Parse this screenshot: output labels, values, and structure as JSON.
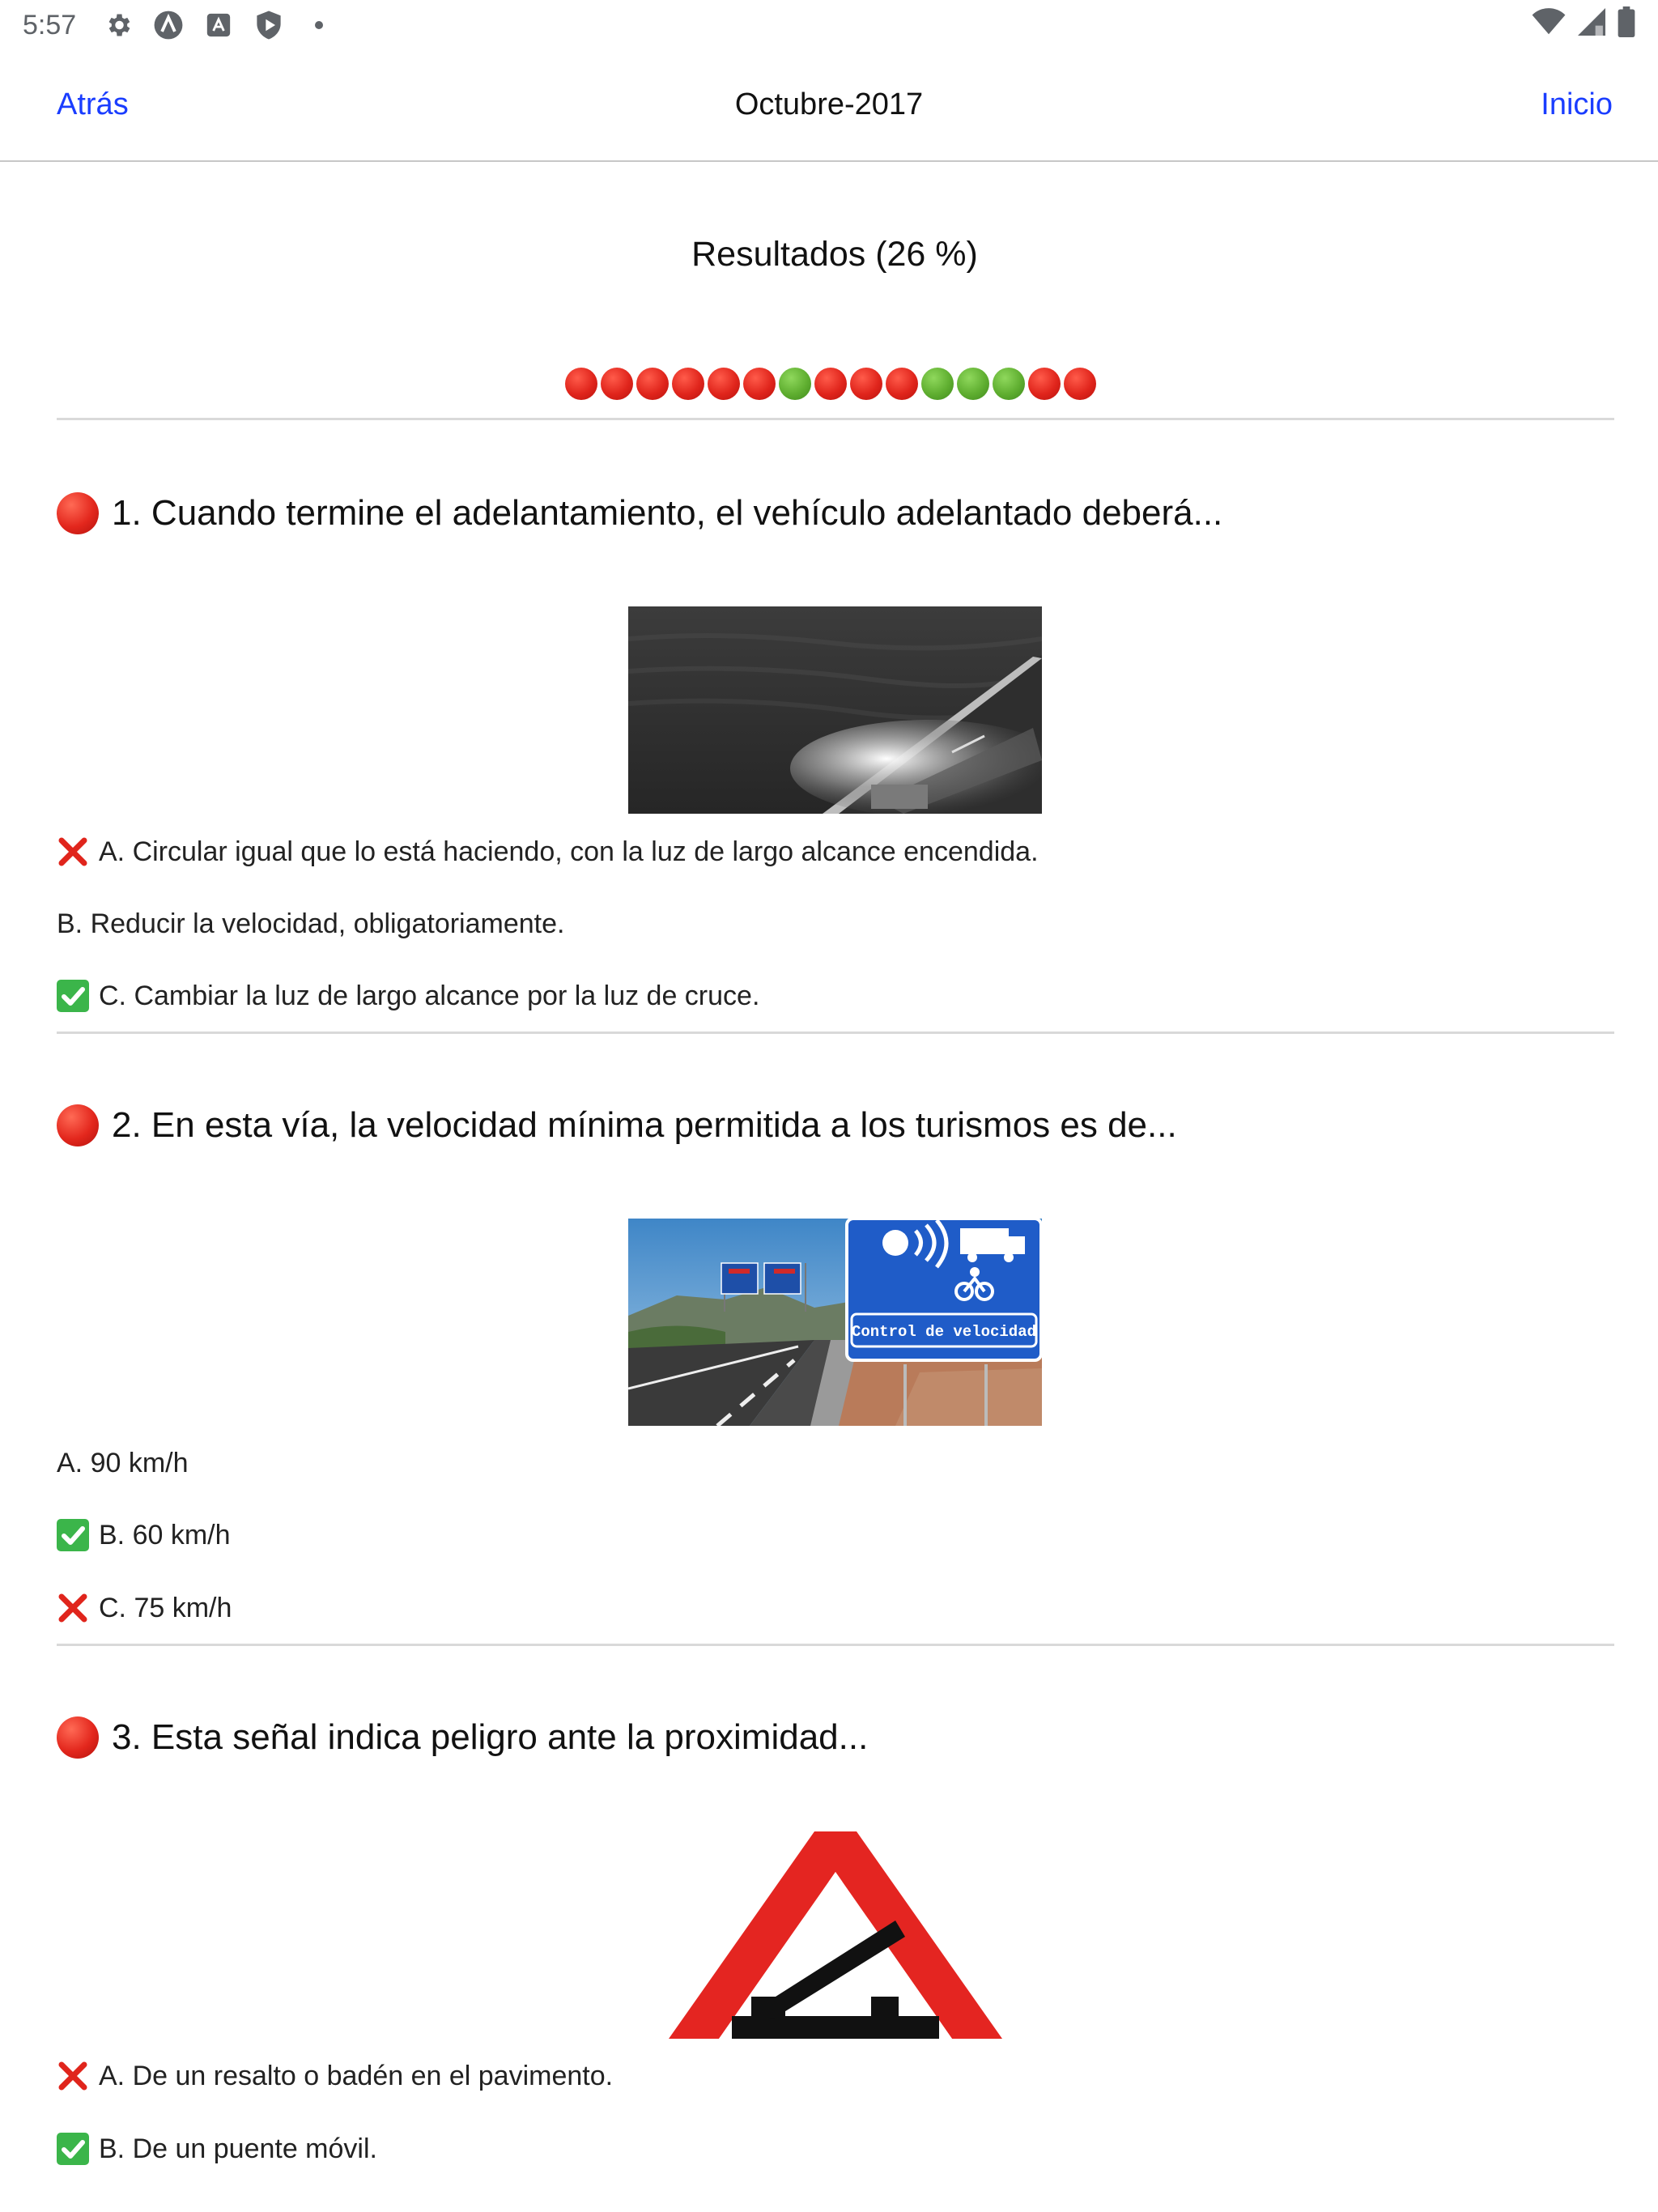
{
  "status_bar": {
    "time": "5:57",
    "icons": [
      "gear-icon",
      "a-circle-icon",
      "a-square-icon",
      "play-shield-icon",
      "dot-icon"
    ],
    "right_icons": [
      "wifi-icon",
      "signal-icon",
      "battery-icon"
    ]
  },
  "nav": {
    "back_label": "Atrás",
    "title": "Octubre-2017",
    "home_label": "Inicio"
  },
  "results": {
    "title": "Resultados (26 %)",
    "dots": [
      "red",
      "red",
      "red",
      "red",
      "red",
      "red",
      "green",
      "red",
      "red",
      "red",
      "green",
      "green",
      "green",
      "red",
      "red"
    ]
  },
  "colors": {
    "link": "#1a3dff",
    "wrong": "#e0251c",
    "correct": "#5fae30"
  },
  "questions": [
    {
      "title": "1. Cuando termine el adelantamiento, el vehículo adelantado deberá...",
      "image": "night-highway-photo",
      "answers": [
        {
          "text": "A. Circular igual que lo está haciendo, con la luz de largo alcance encendida.",
          "mark": "wrong"
        },
        {
          "text": "B. Reducir la velocidad, obligatoriamente.",
          "mark": "none"
        },
        {
          "text": "C. Cambiar la luz de largo alcance por la luz de cruce.",
          "mark": "correct"
        }
      ]
    },
    {
      "title": "2. En esta vía, la velocidad mínima permitida a los turismos es de...",
      "image": "speed-control-sign-photo",
      "sign_text": "Control de velocidad",
      "answers": [
        {
          "text": "A. 90 km/h",
          "mark": "none"
        },
        {
          "text": "B. 60 km/h",
          "mark": "correct"
        },
        {
          "text": "C. 75 km/h",
          "mark": "wrong"
        }
      ]
    },
    {
      "title": "3. Esta señal indica peligro ante la proximidad...",
      "image": "movable-bridge-warning-sign",
      "answers": [
        {
          "text": "A. De un resalto o badén en el pavimento.",
          "mark": "wrong"
        },
        {
          "text": "B. De un puente móvil.",
          "mark": "correct"
        }
      ]
    }
  ]
}
